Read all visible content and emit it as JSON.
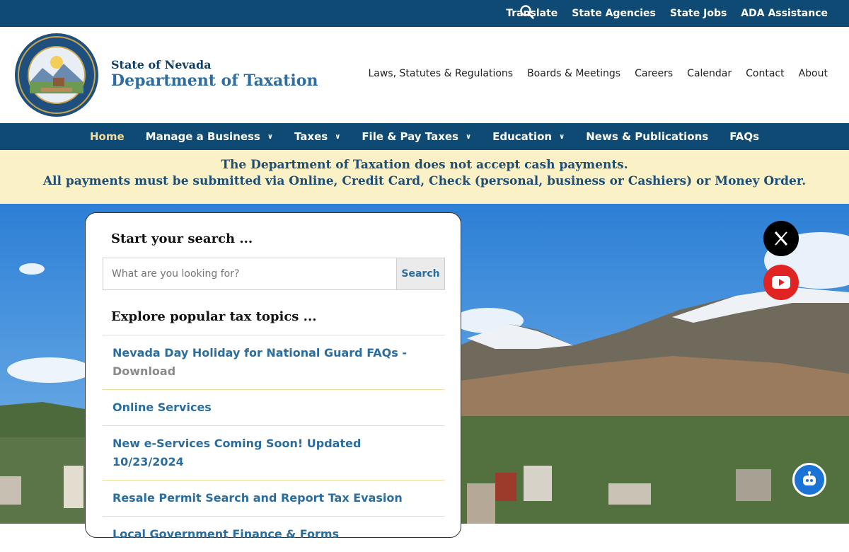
{
  "topbar": {
    "links": [
      "Translate",
      "State Agencies",
      "State Jobs",
      "ADA Assistance"
    ],
    "search_icon": "search-icon"
  },
  "brand": {
    "line1": "State of Nevada",
    "line2": "Department of Taxation"
  },
  "util_nav": [
    "Laws, Statutes & Regulations",
    "Boards & Meetings",
    "Careers",
    "Calendar",
    "Contact",
    "About"
  ],
  "main_nav": {
    "home": "Home",
    "manage_business": "Manage a Business",
    "taxes": "Taxes",
    "file_pay": "File & Pay Taxes",
    "education": "Education",
    "news": "News & Publications",
    "faqs": "FAQs"
  },
  "alert": {
    "line1": "The Department of Taxation does not accept cash payments.",
    "line2": "All payments must be submitted via Online, Credit Card, Check (personal, business or Cashiers) or Money Order."
  },
  "search_card": {
    "heading": "Start your search ...",
    "placeholder": "What are you looking for?",
    "button": "Search",
    "topics_heading": "Explore popular tax topics ...",
    "topics": {
      "t1": "Nevada Day Holiday for National Guard FAQs -",
      "t1_sub": "Download",
      "t2": "Online Services",
      "t3": "New e-Services Coming Soon! Updated 10/23/2024",
      "t4": "Resale Permit Search and Report Tax Evasion",
      "t5": "Local Government Finance & Forms"
    }
  },
  "colors": {
    "navy": "#0e4a73",
    "alert_bg": "#fbf1c6",
    "link_blue": "#2b6d9e",
    "home_active": "#f2de9d"
  },
  "icons": {
    "x": "x-twitter-icon",
    "youtube": "youtube-icon",
    "chatbot": "chatbot-icon"
  }
}
